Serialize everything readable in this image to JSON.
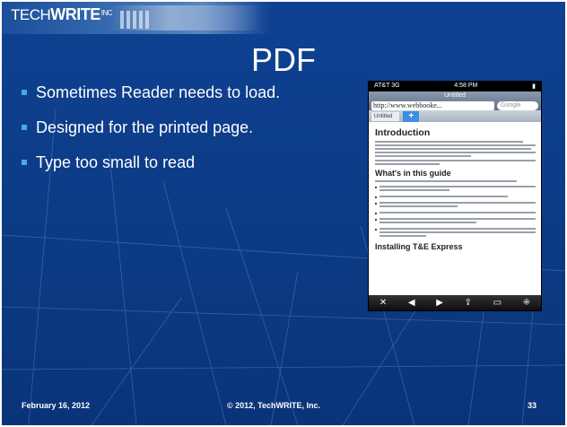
{
  "header": {
    "logo_tech": "TECH",
    "logo_write": "WRITE",
    "logo_inc": "INC"
  },
  "slide": {
    "title": "PDF",
    "bullets": [
      "Sometimes Reader needs to load.",
      "Designed for the printed page.",
      "Type too small to read"
    ]
  },
  "phone": {
    "carrier": "AT&T 3G",
    "time": "4:58 PM",
    "page_title": "Untitled",
    "url": "http://www.webbooke...",
    "search_placeholder": "Google",
    "tab_label": "Untitled",
    "plus_label": "+",
    "heading_intro": "Introduction",
    "heading_guide": "What's in this guide",
    "heading_install": "Installing T&E Express",
    "toolbar_icons": [
      "close-icon",
      "back-icon",
      "forward-icon",
      "share-icon",
      "bookmarks-icon",
      "tabs-icon"
    ]
  },
  "footer": {
    "date": "February 16, 2012",
    "copyright": "© 2012, TechWRITE, Inc.",
    "page_number": "33"
  },
  "colors": {
    "background": "#0f3f8a",
    "bullet": "#4aa8e0",
    "text": "#ffffff"
  }
}
